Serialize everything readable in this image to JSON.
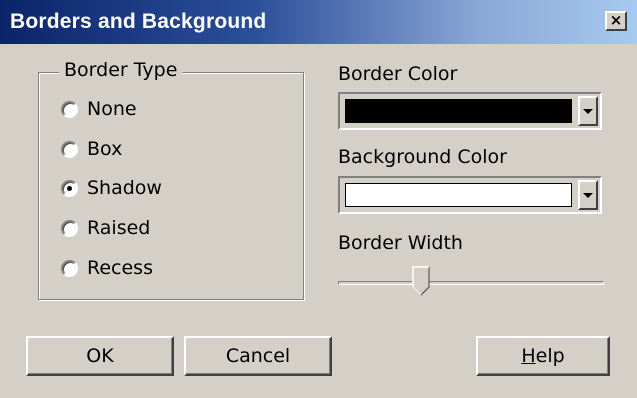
{
  "window": {
    "title": "Borders and Background",
    "close_glyph": "×"
  },
  "border_type": {
    "legend": "Border Type",
    "options": [
      {
        "label": "None",
        "checked": false
      },
      {
        "label": "Box",
        "checked": false
      },
      {
        "label": "Shadow",
        "checked": true
      },
      {
        "label": "Raised",
        "checked": false
      },
      {
        "label": "Recess",
        "checked": false
      }
    ]
  },
  "border_color": {
    "label": "Border Color",
    "value_color": "#000000"
  },
  "background_color": {
    "label": "Background Color",
    "value_color": "#ffffff"
  },
  "border_width": {
    "label": "Border Width",
    "slider_fraction": 0.3
  },
  "buttons": {
    "ok": "OK",
    "cancel": "Cancel",
    "help_first": "H",
    "help_rest": "elp"
  }
}
